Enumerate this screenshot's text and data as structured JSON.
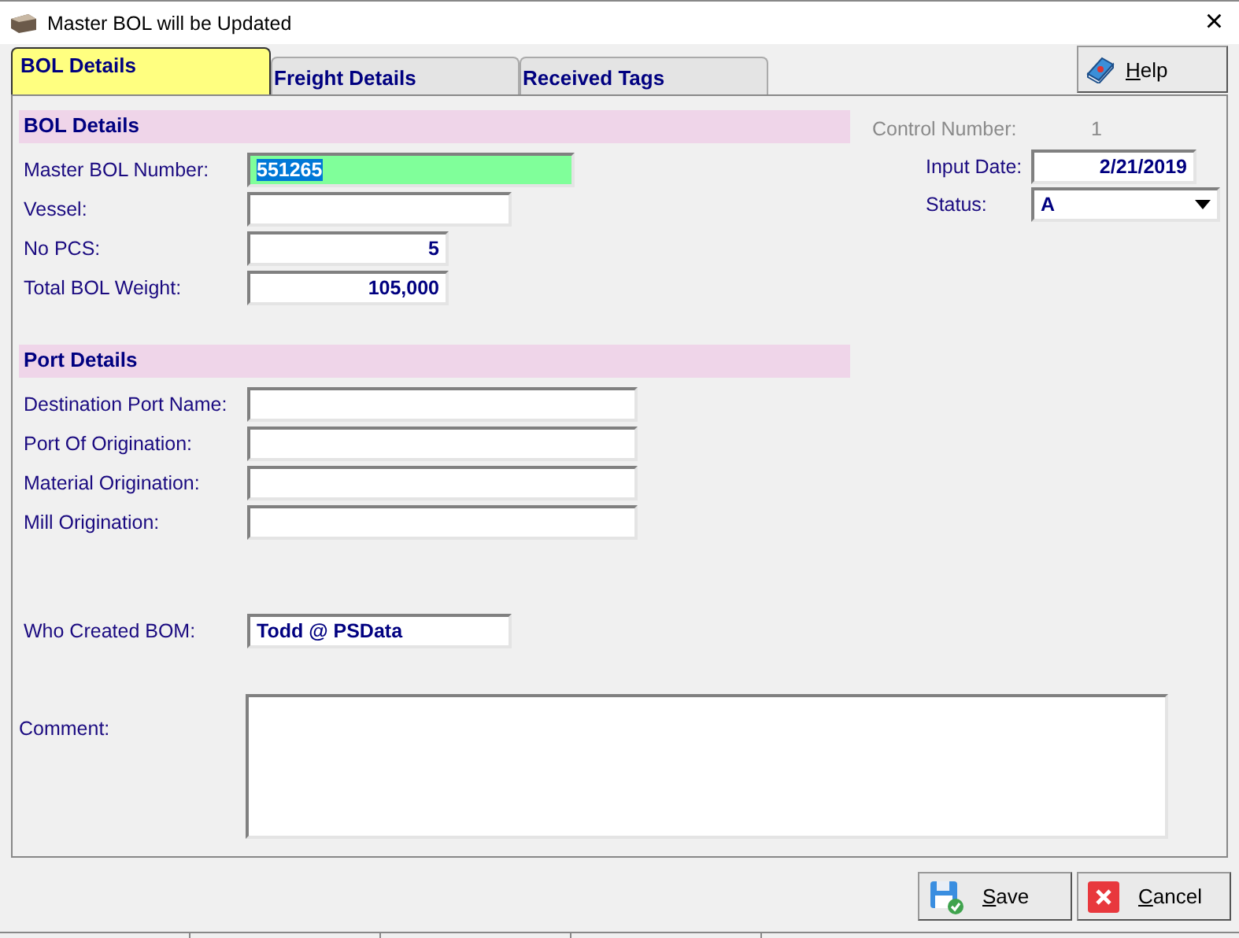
{
  "window": {
    "title": "Master BOL will be Updated",
    "close": "×"
  },
  "tabs": [
    {
      "label": "BOL Details",
      "selected": true
    },
    {
      "label": "Freight Details",
      "selected": false
    },
    {
      "label": "Received Tags",
      "selected": false
    }
  ],
  "help_button": {
    "label": "Help"
  },
  "bol_details": {
    "title": "BOL Details",
    "fields": [
      {
        "label": "Master BOL  Number:",
        "value": "551265",
        "kind": "text",
        "focused": true
      },
      {
        "label": "Vessel:",
        "focused": false
      },
      {
        "label": "No PCS:",
        "value": "5",
        "kind": "number",
        "focused": false
      },
      {
        "label": "Total BOL Weight:",
        "value": "105,000",
        "kind": "number",
        "focused": false
      }
    ]
  },
  "info": {
    "control_number": {
      "label": "Control Number:",
      "value": "1",
      "disabled": true
    },
    "input_date": {
      "label": "Input Date:",
      "value": "2/21/2019"
    },
    "status": {
      "label": "Status:",
      "value": "A"
    }
  },
  "port_details": {
    "title": "Port Details",
    "fields": [
      {
        "label": "Destination Port Name:",
        "focused": false
      },
      {
        "label": "Port Of Origination:",
        "focused": false
      },
      {
        "label": "Material Origination:",
        "focused": false
      },
      {
        "label": "Mill Origination:",
        "focused": false
      }
    ]
  },
  "who_created": {
    "label": "Who Created BOM:",
    "value": "Todd @ PSData"
  },
  "comment": {
    "label": "Comment:"
  },
  "buttons": [
    {
      "label": "Save",
      "kind": "save"
    },
    {
      "label": "Cancel",
      "kind": "cancel"
    }
  ]
}
